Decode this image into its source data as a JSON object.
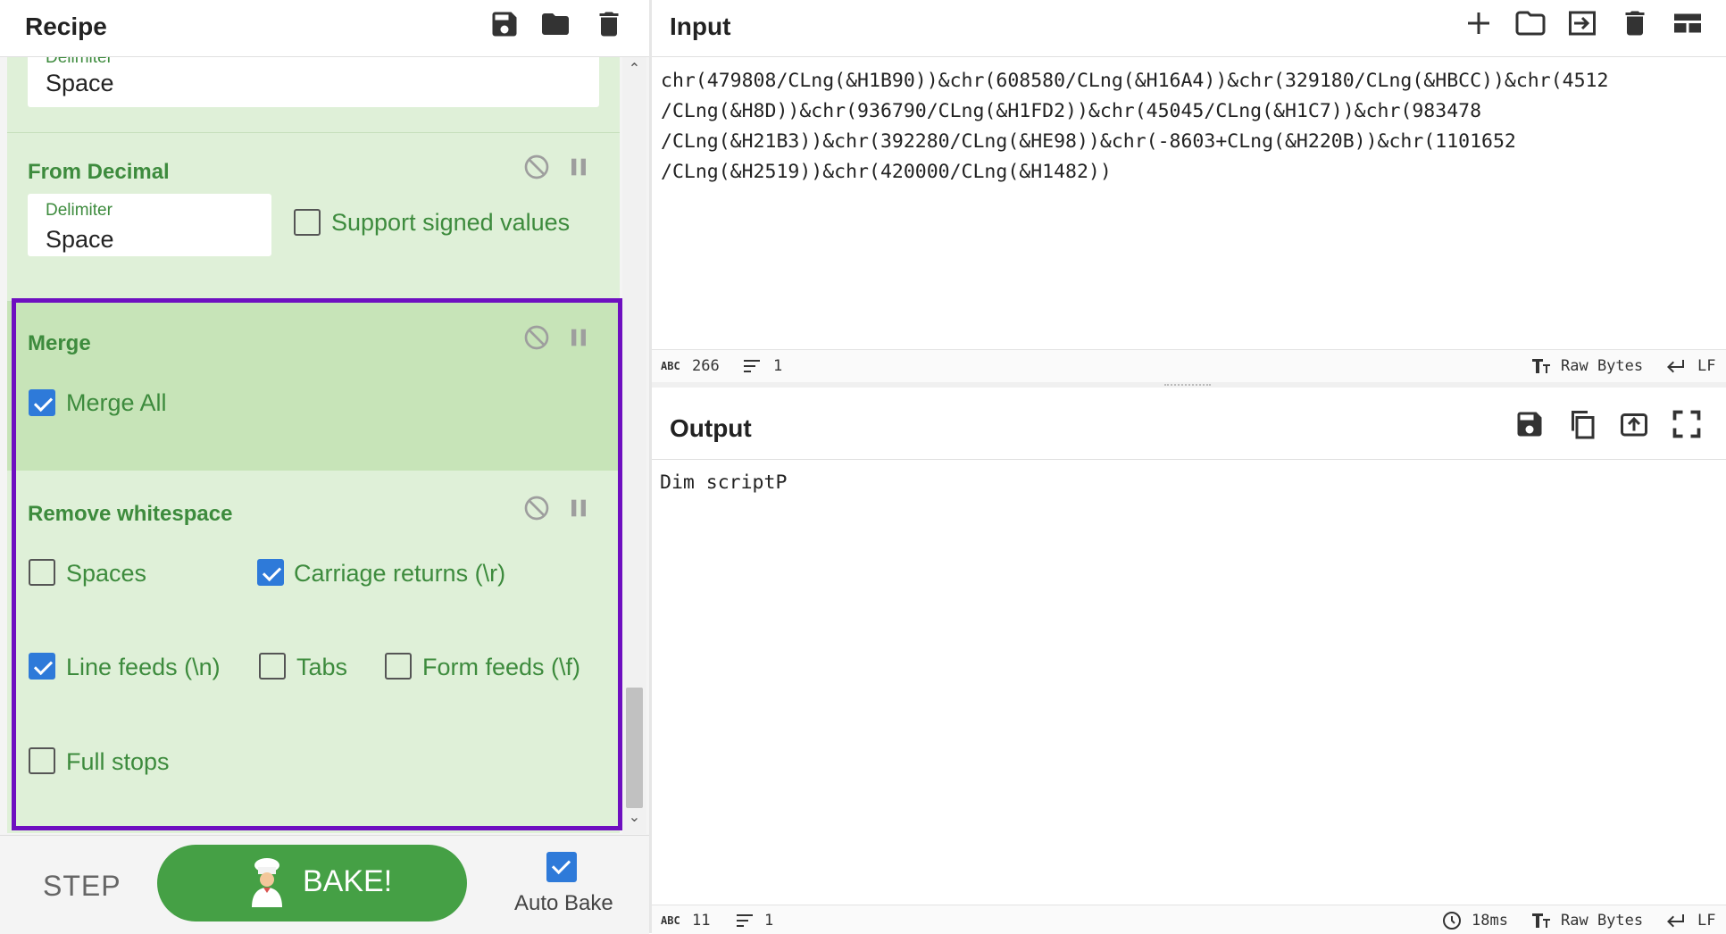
{
  "recipe": {
    "title": "Recipe",
    "operations": [
      {
        "name": "",
        "fields": [
          {
            "label": "Delimiter",
            "value": "Space"
          }
        ]
      },
      {
        "name": "From Decimal",
        "fields": [
          {
            "label": "Delimiter",
            "value": "Space"
          }
        ],
        "checkboxes": [
          {
            "label": "Support signed values",
            "checked": false
          }
        ]
      },
      {
        "name": "Merge",
        "checkboxes": [
          {
            "label": "Merge All",
            "checked": true
          }
        ]
      },
      {
        "name": "Remove whitespace",
        "checkboxes": [
          {
            "label": "Spaces",
            "checked": false
          },
          {
            "label": "Carriage returns (\\r)",
            "checked": true
          },
          {
            "label": "Line feeds (\\n)",
            "checked": true
          },
          {
            "label": "Tabs",
            "checked": false
          },
          {
            "label": "Form feeds (\\f)",
            "checked": false
          },
          {
            "label": "Full stops",
            "checked": false
          }
        ]
      }
    ],
    "step_label": "STEP",
    "bake_label": "BAKE!",
    "autobake_label": "Auto Bake",
    "autobake_checked": true
  },
  "input": {
    "title": "Input",
    "text": "chr(479808/CLng(&H1B90))&chr(608580/CLng(&H16A4))&chr(329180/CLng(&HBCC))&chr(4512\n/CLng(&H8D))&chr(936790/CLng(&H1FD2))&chr(45045/CLng(&H1C7))&chr(983478\n/CLng(&H21B3))&chr(392280/CLng(&HE98))&chr(-8603+CLng(&H220B))&chr(1101652\n/CLng(&H2519))&chr(420000/CLng(&H1482))",
    "status": {
      "length": "266",
      "lines": "1",
      "encoding": "Raw Bytes",
      "eol": "LF"
    }
  },
  "output": {
    "title": "Output",
    "text": "Dim scriptP",
    "status": {
      "length": "11",
      "lines": "1",
      "time": "18ms",
      "encoding": "Raw Bytes",
      "eol": "LF"
    }
  },
  "icons": {
    "abc_badge": "ABC"
  },
  "colors": {
    "op_bg": "#dff0d8",
    "op_active_bg": "#c7e4b8",
    "op_text": "#3d8b3d",
    "highlight_border": "#6e0fc0",
    "bake_button": "#45a045",
    "checkbox_on": "#2e7ad9"
  }
}
